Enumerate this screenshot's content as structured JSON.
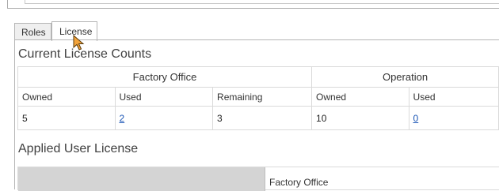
{
  "tabs": {
    "roles_label": "Roles",
    "license_label": "License"
  },
  "current_counts": {
    "title": "Current License Counts",
    "groups": [
      "Factory Office",
      "Operation"
    ],
    "headers": [
      "Owned",
      "Used",
      "Remaining",
      "Owned",
      "Used"
    ],
    "values": {
      "factory_owned": "5",
      "factory_used": "2",
      "factory_remaining": "3",
      "operation_owned": "10",
      "operation_used": "0"
    }
  },
  "applied": {
    "title": "Applied User License",
    "column": "Factory Office"
  },
  "colors": {
    "link": "#1a55b5",
    "header_gray": "#d4d4d4"
  }
}
